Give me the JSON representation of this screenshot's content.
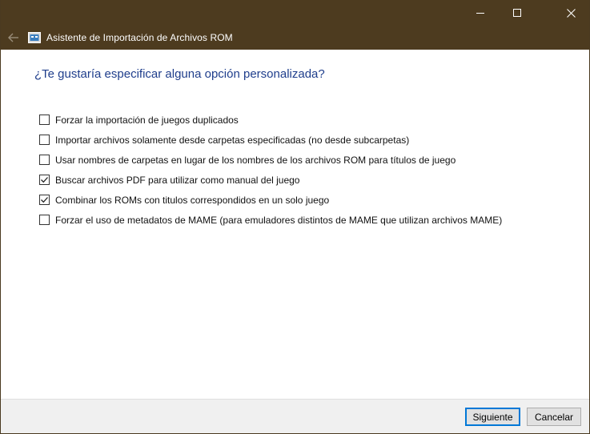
{
  "window": {
    "title": "Asistente de Importación de Archivos ROM",
    "colors": {
      "titlebar": "#4d3b1f",
      "heading": "#1f3e8c",
      "accent": "#0078d7"
    },
    "icons": {
      "back": "back-arrow-icon",
      "app": "app-icon",
      "minimize": "minimize-icon",
      "maximize": "maximize-icon",
      "close": "close-icon"
    }
  },
  "page": {
    "question": "¿Te gustaría especificar alguna opción personalizada?",
    "options": [
      {
        "label": "Forzar la importación de juegos duplicados",
        "checked": false
      },
      {
        "label": "Importar archivos solamente desde carpetas especificadas (no desde subcarpetas)",
        "checked": false
      },
      {
        "label": "Usar nombres de carpetas en lugar de los nombres de los archivos ROM para títulos de juego",
        "checked": false
      },
      {
        "label": "Buscar archivos PDF para utilizar como manual del juego",
        "checked": true
      },
      {
        "label": "Combinar los ROMs con titulos correspondidos en un solo juego",
        "checked": true
      },
      {
        "label": "Forzar el uso de metadatos de MAME (para emuladores distintos de MAME que utilizan archivos MAME)",
        "checked": false
      }
    ]
  },
  "footer": {
    "next_label": "Siguiente",
    "cancel_label": "Cancelar"
  }
}
